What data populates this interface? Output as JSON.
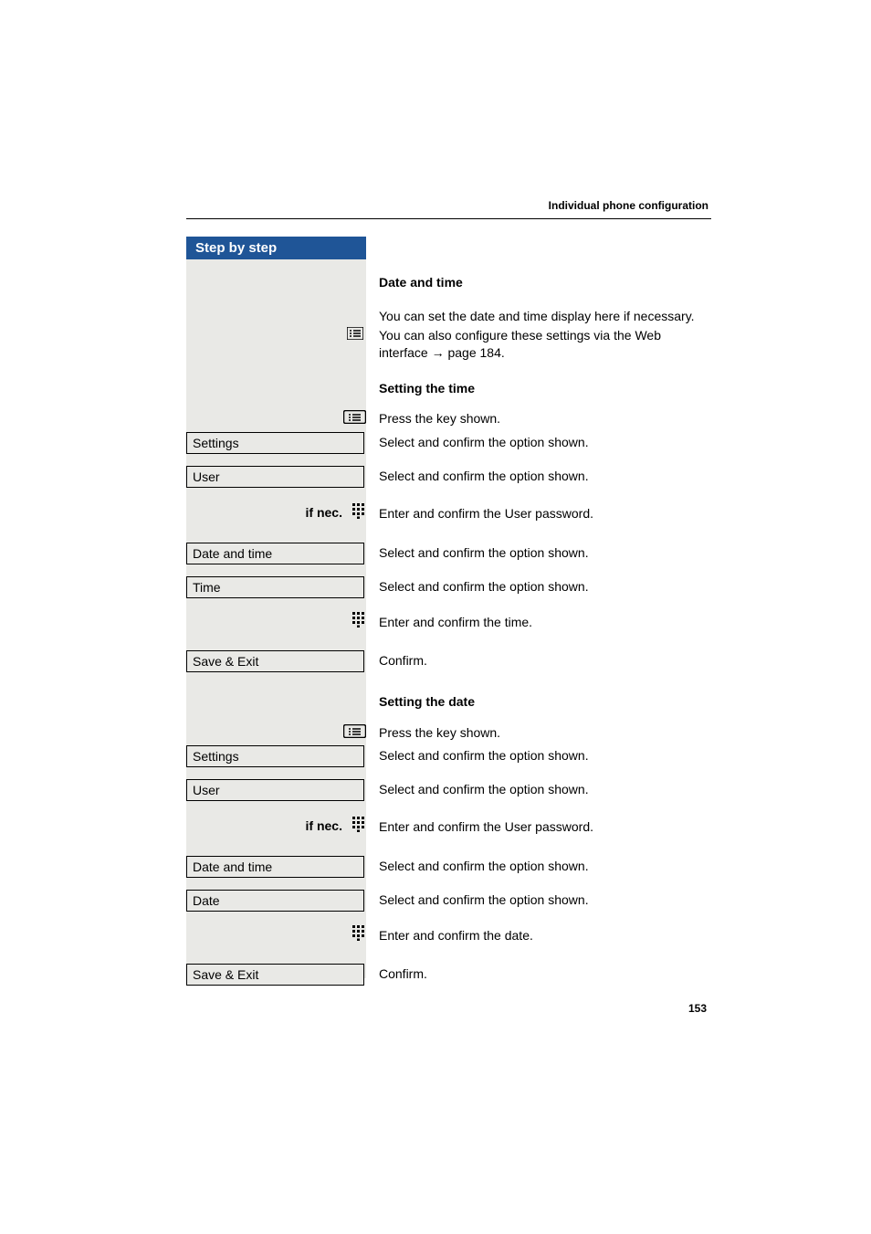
{
  "header": {
    "section_title": "Individual phone configuration"
  },
  "sidebar": {
    "title": "Step by step"
  },
  "content": {
    "h1": "Date and time",
    "intro1": "You can set the date and time display here if necessary.",
    "intro2_a": "You can also configure these settings via the Web interface ",
    "intro2_b": " page 184.",
    "section_time": {
      "title": "Setting the time",
      "key_press": "Press the key shown.",
      "settings_label": "Settings",
      "settings_desc": "Select and confirm the option shown.",
      "user_label": "User",
      "user_desc": "Select and confirm the option shown.",
      "if_nec": "if nec.",
      "password_desc": "Enter and confirm the User password.",
      "datetime_label": "Date and time",
      "datetime_desc": "Select and confirm the option shown.",
      "time_label": "Time",
      "time_desc": "Select and confirm the option shown.",
      "enter_time_desc": "Enter and confirm the time.",
      "save_exit_label": "Save & Exit",
      "save_exit_desc": "Confirm."
    },
    "section_date": {
      "title": "Setting the date",
      "key_press": "Press the key shown.",
      "settings_label": "Settings",
      "settings_desc": "Select and confirm the option shown.",
      "user_label": "User",
      "user_desc": "Select and confirm the option shown.",
      "if_nec": "if nec.",
      "password_desc": "Enter and confirm the User password.",
      "datetime_label": "Date and time",
      "datetime_desc": "Select and confirm the option shown.",
      "date_label": "Date",
      "date_desc": "Select and confirm the option shown.",
      "enter_date_desc": "Enter and confirm the date.",
      "save_exit_label": "Save & Exit",
      "save_exit_desc": "Confirm."
    }
  },
  "page_number": "153"
}
